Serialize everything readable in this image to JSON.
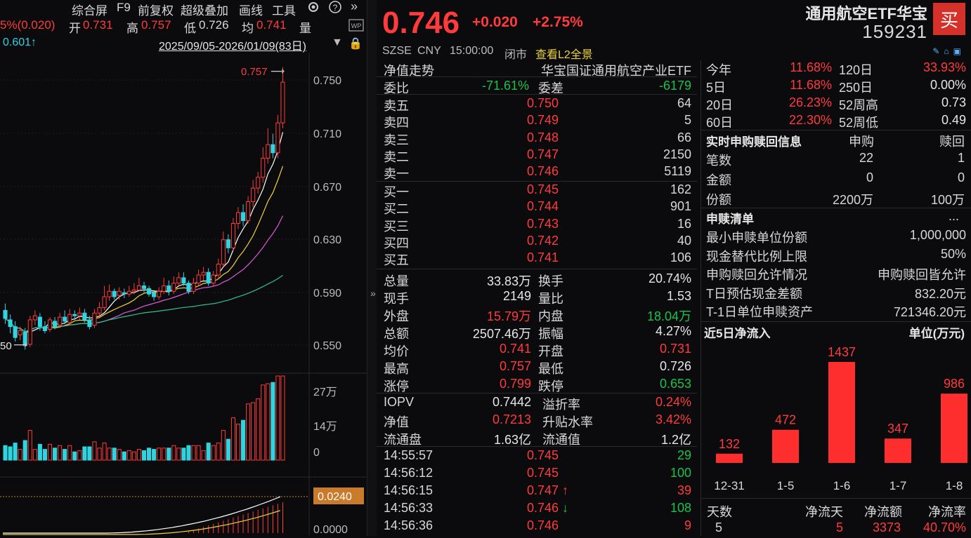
{
  "toolbar": {
    "items": [
      "综合屏",
      "F9",
      "前复权",
      "超级叠加",
      "画线",
      "工具"
    ],
    "gear_icon": "gear-icon",
    "help_icon": "help-icon",
    "collapse_icon": "double-chevron-right-icon"
  },
  "info": {
    "change_text": "5%(0.020)",
    "open_label": "开",
    "open_value": "0.731",
    "high_label": "高",
    "high_value": "0.757",
    "low_label": "低",
    "low_value": "0.726",
    "avg_label": "均",
    "avg_value": "0.741",
    "vol_label": "量",
    "ma_value": "0.601↑",
    "date_range": "2025/09/05-2026/01/09(83日)"
  },
  "kline": {
    "y_ticks": [
      "0.750",
      "0.710",
      "0.670",
      "0.630",
      "0.590",
      "0.550"
    ],
    "high_marker": "0.757",
    "low_marker": "50",
    "vol_ticks": [
      "27万",
      "14万",
      "0"
    ],
    "macd_tag": "0.0240",
    "macd_zero": "0.0000",
    "candles": [
      [
        0.578,
        0.572,
        0.583,
        0.568
      ],
      [
        0.571,
        0.566,
        0.575,
        0.561
      ],
      [
        0.566,
        0.558,
        0.57,
        0.555
      ],
      [
        0.56,
        0.563,
        0.566,
        0.556
      ],
      [
        0.562,
        0.552,
        0.565,
        0.549
      ],
      [
        0.553,
        0.571,
        0.574,
        0.551
      ],
      [
        0.571,
        0.574,
        0.578,
        0.567
      ],
      [
        0.573,
        0.566,
        0.576,
        0.563
      ],
      [
        0.566,
        0.563,
        0.57,
        0.561
      ],
      [
        0.564,
        0.571,
        0.573,
        0.562
      ],
      [
        0.57,
        0.566,
        0.573,
        0.564
      ],
      [
        0.567,
        0.573,
        0.576,
        0.565
      ],
      [
        0.573,
        0.57,
        0.578,
        0.568
      ],
      [
        0.569,
        0.575,
        0.579,
        0.567
      ],
      [
        0.575,
        0.574,
        0.578,
        0.571
      ],
      [
        0.574,
        0.576,
        0.58,
        0.571
      ],
      [
        0.576,
        0.571,
        0.579,
        0.569
      ],
      [
        0.571,
        0.566,
        0.574,
        0.564
      ],
      [
        0.567,
        0.576,
        0.579,
        0.565
      ],
      [
        0.576,
        0.58,
        0.584,
        0.573
      ],
      [
        0.58,
        0.588,
        0.596,
        0.578
      ],
      [
        0.588,
        0.592,
        0.597,
        0.585
      ],
      [
        0.592,
        0.588,
        0.594,
        0.586
      ],
      [
        0.589,
        0.592,
        0.595,
        0.586
      ],
      [
        0.591,
        0.59,
        0.594,
        0.587
      ],
      [
        0.59,
        0.592,
        0.596,
        0.588
      ],
      [
        0.592,
        0.593,
        0.598,
        0.59
      ],
      [
        0.593,
        0.596,
        0.602,
        0.592
      ],
      [
        0.596,
        0.594,
        0.599,
        0.591
      ],
      [
        0.594,
        0.59,
        0.596,
        0.588
      ],
      [
        0.591,
        0.588,
        0.593,
        0.585
      ],
      [
        0.588,
        0.592,
        0.595,
        0.586
      ],
      [
        0.592,
        0.596,
        0.602,
        0.59
      ],
      [
        0.596,
        0.592,
        0.6,
        0.589
      ],
      [
        0.592,
        0.598,
        0.603,
        0.59
      ],
      [
        0.598,
        0.602,
        0.606,
        0.596
      ],
      [
        0.602,
        0.598,
        0.606,
        0.596
      ],
      [
        0.598,
        0.592,
        0.6,
        0.59
      ],
      [
        0.592,
        0.598,
        0.602,
        0.59
      ],
      [
        0.598,
        0.604,
        0.608,
        0.596
      ],
      [
        0.604,
        0.606,
        0.61,
        0.6
      ],
      [
        0.606,
        0.598,
        0.609,
        0.596
      ],
      [
        0.598,
        0.604,
        0.607,
        0.596
      ],
      [
        0.604,
        0.612,
        0.616,
        0.602
      ],
      [
        0.612,
        0.63,
        0.636,
        0.61
      ],
      [
        0.63,
        0.624,
        0.634,
        0.62
      ],
      [
        0.624,
        0.642,
        0.646,
        0.622
      ],
      [
        0.642,
        0.65,
        0.654,
        0.638
      ],
      [
        0.65,
        0.644,
        0.656,
        0.64
      ],
      [
        0.644,
        0.658,
        0.662,
        0.642
      ],
      [
        0.658,
        0.668,
        0.674,
        0.654
      ],
      [
        0.668,
        0.676,
        0.68,
        0.664
      ],
      [
        0.676,
        0.69,
        0.698,
        0.672
      ],
      [
        0.69,
        0.7,
        0.712,
        0.686
      ],
      [
        0.7,
        0.694,
        0.708,
        0.69
      ],
      [
        0.694,
        0.716,
        0.722,
        0.69
      ],
      [
        0.716,
        0.746,
        0.757,
        0.712
      ]
    ]
  },
  "quote": {
    "price": "0.746",
    "change": "+0.020",
    "change_pct": "+2.75%",
    "exchange": "SZSE",
    "currency": "CNY",
    "time": "15:00:00",
    "status": "闭市",
    "l2_link": "查看L2全景",
    "etf_name": "通用航空ETF华宝",
    "etf_code": "159231",
    "buy_label": "买",
    "nav_trend_label": "净值走势",
    "fund_full_name": "华宝国证通用航空产业ETF",
    "wb_label": "委比",
    "wb_value": "-71.61%",
    "wc_label": "委差",
    "wc_value": "-6179",
    "asks": [
      {
        "label": "卖五",
        "price": "0.750",
        "vol": "64"
      },
      {
        "label": "卖四",
        "price": "0.749",
        "vol": "5"
      },
      {
        "label": "卖三",
        "price": "0.748",
        "vol": "66"
      },
      {
        "label": "卖二",
        "price": "0.747",
        "vol": "2150"
      },
      {
        "label": "卖一",
        "price": "0.746",
        "vol": "5119"
      }
    ],
    "bids": [
      {
        "label": "买一",
        "price": "0.745",
        "vol": "162"
      },
      {
        "label": "买二",
        "price": "0.744",
        "vol": "901"
      },
      {
        "label": "买三",
        "price": "0.743",
        "vol": "16"
      },
      {
        "label": "买四",
        "price": "0.742",
        "vol": "40"
      },
      {
        "label": "买五",
        "price": "0.741",
        "vol": "106"
      }
    ],
    "stats": [
      {
        "l1": "总量",
        "v1": "33.83万",
        "c1": "white",
        "l2": "换手",
        "v2": "20.74%",
        "c2": "white"
      },
      {
        "l1": "现手",
        "v1": "2149",
        "c1": "white",
        "l2": "量比",
        "v2": "1.53",
        "c2": "white"
      },
      {
        "l1": "外盘",
        "v1": "15.79万",
        "c1": "red",
        "l2": "内盘",
        "v2": "18.04万",
        "c2": "green"
      },
      {
        "l1": "总额",
        "v1": "2507.46万",
        "c1": "white",
        "l2": "振幅",
        "v2": "4.27%",
        "c2": "white"
      },
      {
        "l1": "均价",
        "v1": "0.741",
        "c1": "red",
        "l2": "开盘",
        "v2": "0.731",
        "c2": "red"
      },
      {
        "l1": "最高",
        "v1": "0.757",
        "c1": "red",
        "l2": "最低",
        "v2": "0.726",
        "c2": "white"
      },
      {
        "l1": "涨停",
        "v1": "0.799",
        "c1": "red",
        "l2": "跌停",
        "v2": "0.653",
        "c2": "green"
      }
    ],
    "fund_stats": [
      {
        "l1": "IOPV",
        "v1": "0.7442",
        "c1": "white",
        "l2": "溢折率",
        "v2": "0.24%",
        "c2": "red"
      },
      {
        "l1": "净值",
        "v1": "0.7213",
        "c1": "red",
        "l2": "升贴水率",
        "v2": "3.42%",
        "c2": "red"
      },
      {
        "l1": "流通盘",
        "v1": "1.63亿",
        "c1": "white",
        "l2": "流通值",
        "v2": "1.2亿",
        "c2": "white"
      }
    ],
    "ticks": [
      {
        "time": "14:55:57",
        "price": "0.745",
        "arrow": "",
        "vol": "29",
        "vc": "green"
      },
      {
        "time": "14:56:12",
        "price": "0.745",
        "arrow": "",
        "vol": "100",
        "vc": "green"
      },
      {
        "time": "14:56:15",
        "price": "0.747",
        "arrow": "↑",
        "vol": "39",
        "vc": "red"
      },
      {
        "time": "14:56:33",
        "price": "0.746",
        "arrow": "↓",
        "vol": "108",
        "vc": "green"
      },
      {
        "time": "14:56:36",
        "price": "0.746",
        "arrow": "",
        "vol": "9",
        "vc": "red"
      }
    ]
  },
  "perf": [
    {
      "l1": "今年",
      "v1": "11.68%",
      "c1": "red",
      "l2": "120日",
      "v2": "33.93%",
      "c2": "red"
    },
    {
      "l1": "5日",
      "v1": "11.68%",
      "c1": "red",
      "l2": "250日",
      "v2": "0.00%",
      "c2": "white"
    },
    {
      "l1": "20日",
      "v1": "26.23%",
      "c1": "red",
      "l2": "52周高",
      "v2": "0.73",
      "c2": "white"
    },
    {
      "l1": "60日",
      "v1": "22.30%",
      "c1": "red",
      "l2": "52周低",
      "v2": "0.49",
      "c2": "white"
    }
  ],
  "redemption": {
    "title": "实时申购赎回信息",
    "col_sub": "申购",
    "col_red": "赎回",
    "rows": [
      {
        "label": "笔数",
        "sub": "22",
        "red": "1"
      },
      {
        "label": "金额",
        "sub": "0",
        "red": "0"
      },
      {
        "label": "份额",
        "sub": "2200万",
        "red": "100万"
      }
    ]
  },
  "rlist": {
    "title": "申赎清单",
    "more": "...",
    "rows": [
      {
        "label": "最小申赎单位份额",
        "value": "1,000,000"
      },
      {
        "label": "现金替代比例上限",
        "value": "50%"
      },
      {
        "label": "申购赎回允许情况",
        "value": "申购赎回皆允许"
      },
      {
        "label": "T日预估现金差额",
        "value": "832.20元"
      },
      {
        "label": "T-1日单位申赎资产",
        "value": "721346.20元"
      }
    ]
  },
  "netflow": {
    "title": "近5日净流入",
    "unit": "单位(万元)",
    "footer": {
      "days_label": "天数",
      "days_value": "5",
      "inflow_days_label": "净流天",
      "inflow_days_value": "5",
      "amount_label": "净流额",
      "amount_value": "3373",
      "rate_label": "净流率",
      "rate_value": "40.70%"
    }
  },
  "chart_data": {
    "type": "bar",
    "categories": [
      "12-31",
      "1-5",
      "1-6",
      "1-7",
      "1-8"
    ],
    "values": [
      132,
      472,
      1437,
      347,
      986
    ],
    "title": "近5日净流入",
    "ylabel": "单位(万元)",
    "color": "#ff2e2e"
  }
}
